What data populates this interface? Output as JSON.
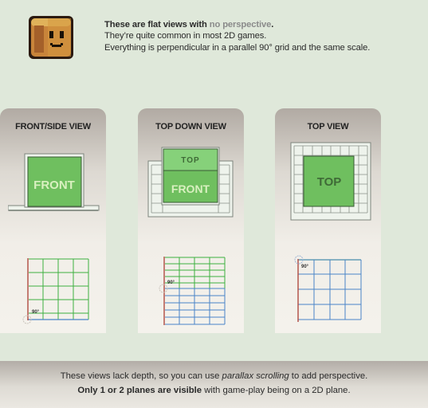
{
  "intro": {
    "heading_pre": "These are flat views with",
    "heading_accent": "no perspective",
    "heading_post": ".",
    "line2": "They’re quite common in most 2D games.",
    "line3": "Everything is perpendicular in a parallel 90° grid and the same scale."
  },
  "panels": [
    {
      "title": "FRONT/SIDE  VIEW",
      "block_label": "FRONT",
      "angle_label": "90°"
    },
    {
      "title": "TOP DOWN VIEW",
      "top_label": "TOP",
      "front_label": "FRONT",
      "angle_label": "90°"
    },
    {
      "title": "TOP VIEW",
      "block_label": "TOP",
      "angle_label": "90°"
    }
  ],
  "footer": {
    "l1_pre": "These views lack depth, so you can use ",
    "l1_italic": "parallax scrolling",
    "l1_post": " to add perspective.",
    "l2_bold": "Only 1 or 2 planes are visible",
    "l2_post": " with game-play being on a 2D plane."
  },
  "colors": {
    "green_face": "#6fbf5f",
    "green_light": "#86d17a",
    "green_text": "#d9f0c0",
    "grid_red": "#b04a40",
    "grid_green": "#3db040",
    "grid_blue": "#4a84c8",
    "mascot_brown": "#c8843a"
  }
}
